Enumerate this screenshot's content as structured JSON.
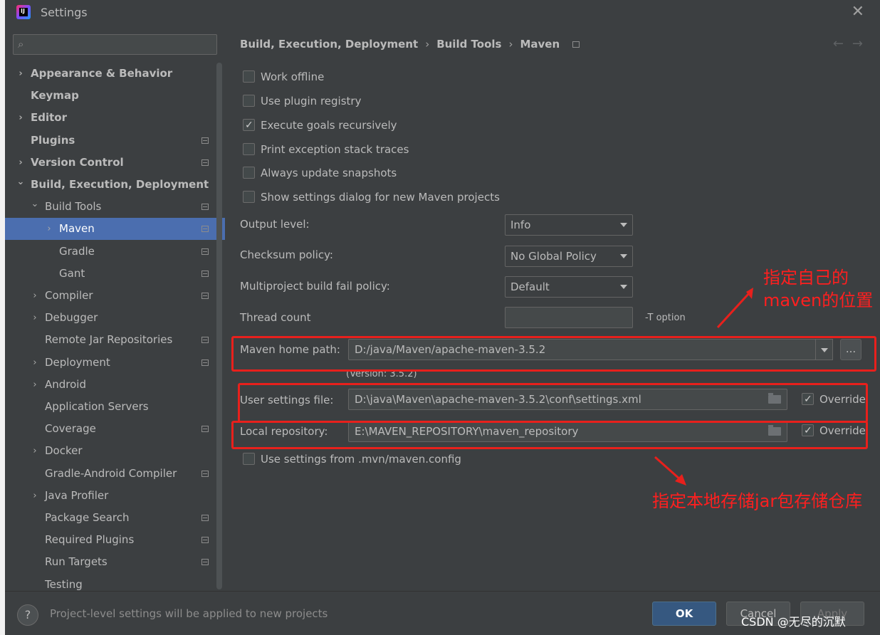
{
  "window": {
    "title": "Settings"
  },
  "search": {
    "placeholder": ""
  },
  "sidebar": {
    "items": [
      {
        "label": "Appearance & Behavior",
        "bold": true,
        "chevron": "right",
        "indent": 0,
        "project": false
      },
      {
        "label": "Keymap",
        "bold": true,
        "chevron": "",
        "indent": 0,
        "project": false
      },
      {
        "label": "Editor",
        "bold": true,
        "chevron": "right",
        "indent": 0,
        "project": false
      },
      {
        "label": "Plugins",
        "bold": true,
        "chevron": "",
        "indent": 0,
        "project": true
      },
      {
        "label": "Version Control",
        "bold": true,
        "chevron": "right",
        "indent": 0,
        "project": true
      },
      {
        "label": "Build, Execution, Deployment",
        "bold": true,
        "chevron": "down",
        "indent": 0,
        "project": false
      },
      {
        "label": "Build Tools",
        "bold": false,
        "chevron": "down",
        "indent": 1,
        "project": true
      },
      {
        "label": "Maven",
        "bold": false,
        "chevron": "right",
        "indent": 2,
        "project": true,
        "selected": true
      },
      {
        "label": "Gradle",
        "bold": false,
        "chevron": "",
        "indent": 2,
        "project": true
      },
      {
        "label": "Gant",
        "bold": false,
        "chevron": "",
        "indent": 2,
        "project": true
      },
      {
        "label": "Compiler",
        "bold": false,
        "chevron": "right",
        "indent": 1,
        "project": true
      },
      {
        "label": "Debugger",
        "bold": false,
        "chevron": "right",
        "indent": 1,
        "project": false
      },
      {
        "label": "Remote Jar Repositories",
        "bold": false,
        "chevron": "",
        "indent": 1,
        "project": true
      },
      {
        "label": "Deployment",
        "bold": false,
        "chevron": "right",
        "indent": 1,
        "project": true
      },
      {
        "label": "Android",
        "bold": false,
        "chevron": "right",
        "indent": 1,
        "project": false
      },
      {
        "label": "Application Servers",
        "bold": false,
        "chevron": "",
        "indent": 1,
        "project": false
      },
      {
        "label": "Coverage",
        "bold": false,
        "chevron": "",
        "indent": 1,
        "project": true
      },
      {
        "label": "Docker",
        "bold": false,
        "chevron": "right",
        "indent": 1,
        "project": false
      },
      {
        "label": "Gradle-Android Compiler",
        "bold": false,
        "chevron": "",
        "indent": 1,
        "project": true
      },
      {
        "label": "Java Profiler",
        "bold": false,
        "chevron": "right",
        "indent": 1,
        "project": false
      },
      {
        "label": "Package Search",
        "bold": false,
        "chevron": "",
        "indent": 1,
        "project": true
      },
      {
        "label": "Required Plugins",
        "bold": false,
        "chevron": "",
        "indent": 1,
        "project": true
      },
      {
        "label": "Run Targets",
        "bold": false,
        "chevron": "",
        "indent": 1,
        "project": true
      },
      {
        "label": "Testing",
        "bold": false,
        "chevron": "",
        "indent": 1,
        "project": false
      }
    ]
  },
  "breadcrumb": {
    "part1": "Build, Execution, Deployment",
    "part2": "Build Tools",
    "part3": "Maven",
    "sep": "›"
  },
  "nav": {
    "back": "←",
    "forward": "→"
  },
  "checkboxes": {
    "work_offline": {
      "label": "Work offline",
      "checked": false
    },
    "plugin_registry": {
      "label": "Use plugin registry",
      "checked": false
    },
    "goals_recursively": {
      "label": "Execute goals recursively",
      "checked": true
    },
    "exception_traces": {
      "label": "Print exception stack traces",
      "checked": false
    },
    "update_snapshots": {
      "label": "Always update snapshots",
      "checked": false
    },
    "settings_dialog": {
      "label": "Show settings dialog for new Maven projects",
      "checked": false
    },
    "mvn_config": {
      "label": "Use settings from .mvn/maven.config",
      "checked": false
    }
  },
  "fields": {
    "output_level": {
      "label": "Output level:",
      "value": "Info"
    },
    "checksum_policy": {
      "label": "Checksum policy:",
      "value": "No Global Policy"
    },
    "fail_policy": {
      "label": "Multiproject build fail policy:",
      "value": "Default"
    },
    "thread_count": {
      "label": "Thread count",
      "value": "",
      "suffix": "-T option"
    },
    "maven_home": {
      "label": "Maven home path:",
      "value": "D:/java/Maven/apache-maven-3.5.2",
      "version": "(Version: 3.5.2)",
      "browse": "..."
    },
    "user_settings": {
      "label": "User settings file:",
      "value": "D:\\java\\Maven\\apache-maven-3.5.2\\conf\\settings.xml",
      "override": "Override",
      "override_checked": true
    },
    "local_repo": {
      "label": "Local repository:",
      "value": "E:\\MAVEN_REPOSITORY\\maven_repository",
      "override": "Override",
      "override_checked": true
    }
  },
  "annotations": {
    "maven_location_line1": "指定自己的",
    "maven_location_line2": "maven的位置",
    "local_repo_note": "指定本地存储jar包存储仓库",
    "color": "#e8201c"
  },
  "footer": {
    "help": "?",
    "note": "Project-level settings will be applied to new projects",
    "ok": "OK",
    "cancel": "Cancel",
    "apply": "Apply"
  },
  "watermark": "CSDN @无尽的沉默"
}
